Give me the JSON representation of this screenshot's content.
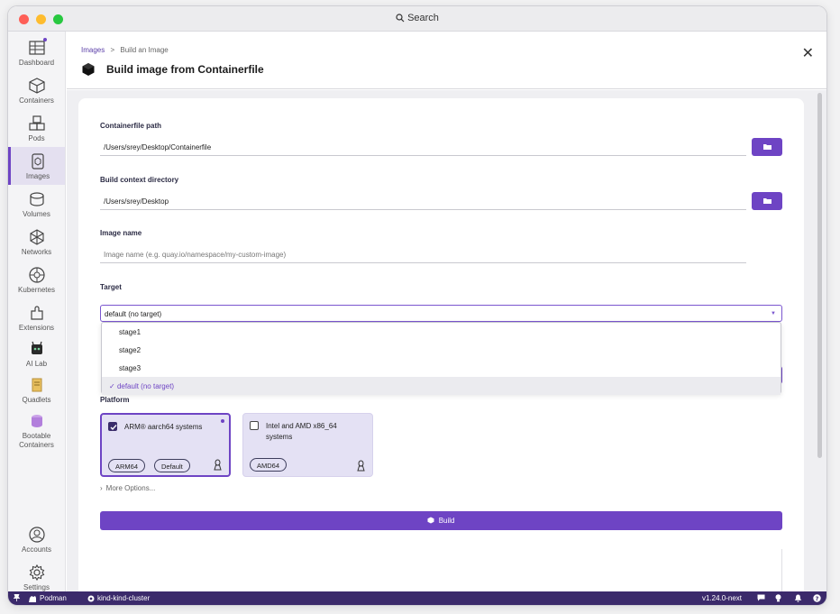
{
  "titlebar": {
    "search_label": "Search"
  },
  "nav": [
    {
      "id": "dashboard",
      "label": "Dashboard",
      "icon": "dashboard-icon"
    },
    {
      "id": "containers",
      "label": "Containers",
      "icon": "container-icon"
    },
    {
      "id": "pods",
      "label": "Pods",
      "icon": "pods-icon"
    },
    {
      "id": "images",
      "label": "Images",
      "icon": "images-icon",
      "active": true
    },
    {
      "id": "volumes",
      "label": "Volumes",
      "icon": "volumes-icon"
    },
    {
      "id": "networks",
      "label": "Networks",
      "icon": "networks-icon"
    },
    {
      "id": "kubernetes",
      "label": "Kubernetes",
      "icon": "kubernetes-icon"
    },
    {
      "id": "extensions",
      "label": "Extensions",
      "icon": "extensions-icon"
    },
    {
      "id": "ailab",
      "label": "AI Lab",
      "icon": "ai-lab-icon"
    },
    {
      "id": "quadlets",
      "label": "Quadlets",
      "icon": "quadlets-icon"
    },
    {
      "id": "bootable",
      "label": "Bootable Containers",
      "icon": "bootable-containers-icon"
    },
    {
      "id": "accounts",
      "label": "Accounts",
      "icon": "accounts-icon"
    },
    {
      "id": "settings",
      "label": "Settings",
      "icon": "settings-icon"
    }
  ],
  "header": {
    "breadcrumb_link": "Images",
    "breadcrumb_sep": ">",
    "breadcrumb_current": "Build an Image",
    "title": "Build image from Containerfile"
  },
  "form": {
    "containerfile_label": "Containerfile path",
    "containerfile_value": "/Users/srey/Desktop/Containerfile",
    "context_label": "Build context directory",
    "context_value": "/Users/srey/Desktop",
    "image_name_label": "Image name",
    "image_name_placeholder": "Image name (e.g. quay.io/namespace/my-custom-image)",
    "target_label": "Target",
    "target_value": "default (no target)",
    "target_options": [
      "stage1",
      "stage2",
      "stage3",
      "default (no target)"
    ],
    "platform_label": "Platform",
    "platforms": [
      {
        "name": "ARM® aarch64 systems",
        "checked": true,
        "tags": [
          "ARM64",
          "Default"
        ]
      },
      {
        "name": "Intel and AMD x86_64 systems",
        "checked": false,
        "tags": [
          "AMD64"
        ]
      }
    ],
    "more_options": "More Options...",
    "build_label": "Build"
  },
  "statusbar": {
    "provider": "Podman",
    "cluster": "kind-kind-cluster",
    "version": "v1.24.0-next"
  },
  "colors": {
    "accent": "#6e44c4",
    "statusbar": "#3b2a6b",
    "card_tint": "#e4e1f4"
  }
}
